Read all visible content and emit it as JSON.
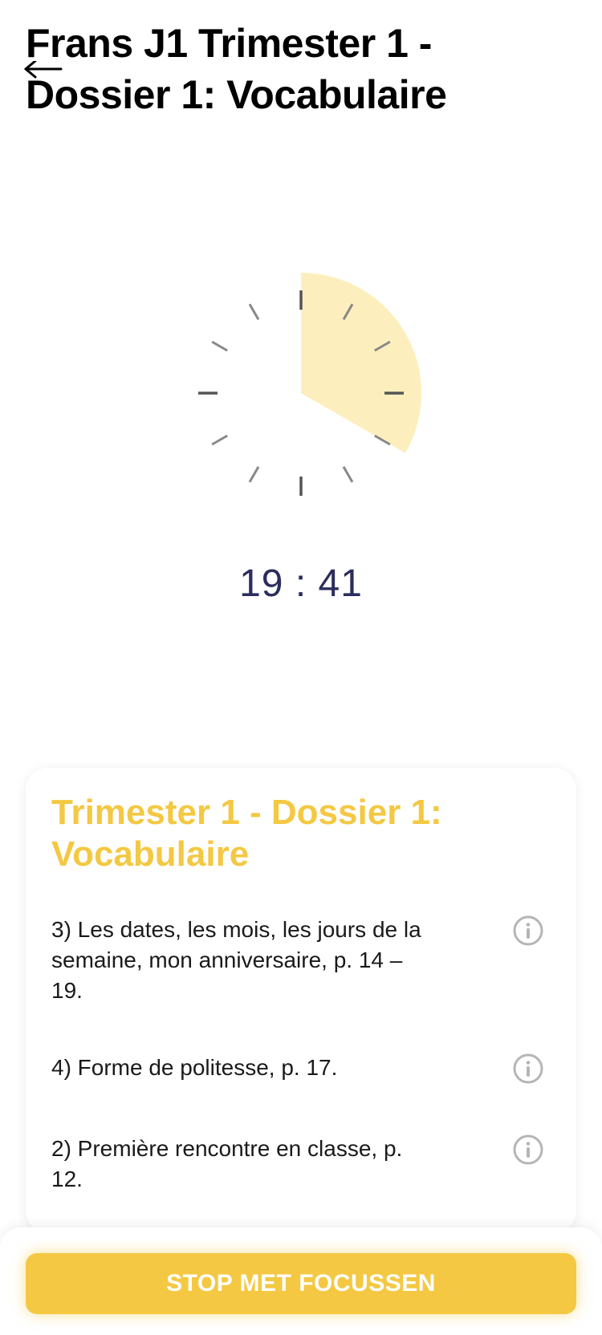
{
  "header": {
    "title": "Frans J1 Trimester 1 - Dossier 1: Vocabulaire",
    "back_icon": "arrow-left-icon"
  },
  "timer": {
    "remaining": "19 : 41",
    "progress_fraction": 0.333,
    "wedge_color": "#fdefbd",
    "text_color": "#2b2d5c"
  },
  "card": {
    "title": "Trimester 1 - Dossier 1: Vocabulaire",
    "title_color": "#f4c842",
    "items": [
      {
        "text": "3) Les dates, les mois, les jours de la semaine, mon anniversaire, p. 14 – 19.",
        "icon": "info-icon"
      },
      {
        "text": "4) Forme de politesse, p. 17.",
        "icon": "info-icon"
      },
      {
        "text": "2) Première rencontre en classe, p. 12.",
        "icon": "info-icon"
      }
    ]
  },
  "footer": {
    "stop_label": "STOP MET FOCUSSEN",
    "button_color": "#f4c842"
  }
}
